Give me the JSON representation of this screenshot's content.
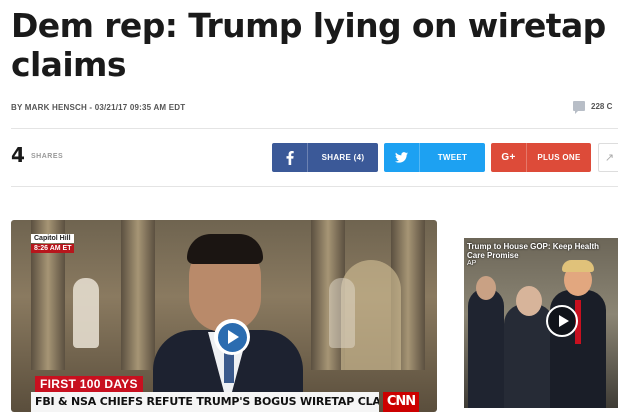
{
  "article": {
    "headline": "Dem rep: Trump lying on wiretap claims",
    "byline": "BY MARK HENSCH - 03/21/17 09:35 AM EDT",
    "comment_count": "228 C"
  },
  "share_bar": {
    "count": "4",
    "count_label": "SHARES",
    "facebook_label": "SHARE (4)",
    "twitter_label": "TWEET",
    "googleplus_icon": "G+",
    "googleplus_label": "PLUS ONE",
    "more_icon": "↗"
  },
  "main_video": {
    "location_tag": "Capitol Hill",
    "time_tag": "8:26 AM ET",
    "banner": "FIRST 100 DAYS",
    "chyron": "FBI & NSA CHIEFS REFUTE TRUMP'S BOGUS WIRETAP CLAIM",
    "network_logo": "CNN"
  },
  "side_video": {
    "title": "Trump to House GOP: Keep Health Care Promise",
    "source": "AP"
  },
  "colors": {
    "facebook": "#3b5998",
    "twitter": "#1da1f2",
    "googleplus": "#dd4b39",
    "play_button": "#2b6cb0",
    "cnn_red": "#cc0000"
  }
}
